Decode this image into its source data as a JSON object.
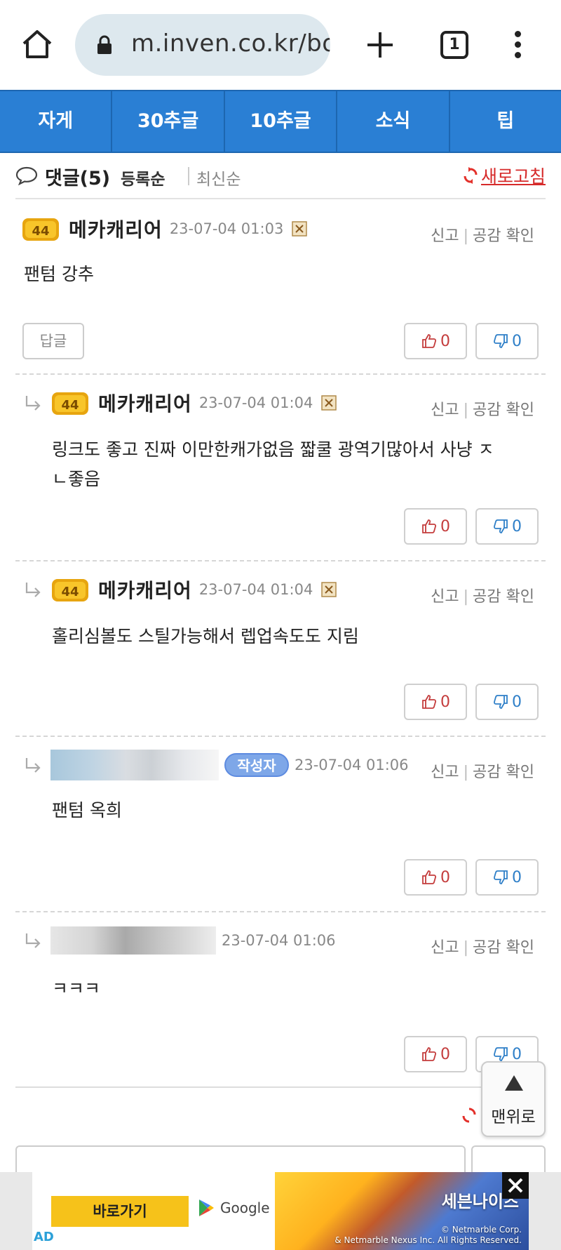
{
  "browser": {
    "url": "m.inven.co.kr/bo",
    "tab_count": "1"
  },
  "nav": {
    "items": [
      "자게",
      "30추글",
      "10추글",
      "소식",
      "팁"
    ]
  },
  "comments_header": {
    "title": "댓글(5)",
    "sort_registered": "등록순",
    "sort_latest": "최신순",
    "refresh_label": "새로고침"
  },
  "meta_labels": {
    "report": "신고",
    "sep": "|",
    "like_check": "공감 확인",
    "reply": "답글"
  },
  "comments": [
    {
      "level": "44",
      "nickname": "메카캐리어",
      "date": "23-07-04 01:03",
      "text": "팬텀 강추",
      "likes": "0",
      "dislikes": "0"
    },
    {
      "level": "44",
      "nickname": "메카캐리어",
      "date": "23-07-04 01:04",
      "text_line1": "링크도 좋고 진짜 이만한캐가없음 짧쿨 광역기많아서 사냥 ㅈ",
      "text_line2": "ㄴ좋음",
      "likes": "0",
      "dislikes": "0"
    },
    {
      "level": "44",
      "nickname": "메카캐리어",
      "date": "23-07-04 01:04",
      "text": "홀리심볼도 스틸가능해서 렙업속도도 지림",
      "likes": "0",
      "dislikes": "0"
    },
    {
      "author_badge": "작성자",
      "date": "23-07-04 01:06",
      "text": "팬텀 옥희",
      "likes": "0",
      "dislikes": "0"
    },
    {
      "date": "23-07-04 01:06",
      "text": "ㅋㅋㅋ",
      "likes": "0",
      "dislikes": "0"
    }
  ],
  "top_button": {
    "label": "맨위로"
  },
  "ad": {
    "cta": "바로가기",
    "store": "Google Play",
    "game_title": "세븐나이츠",
    "copyright_1": "© Netmarble Corp.",
    "copyright_2": "& Netmarble Nexus Inc. All Rights Reserved.",
    "tag": "AD"
  }
}
